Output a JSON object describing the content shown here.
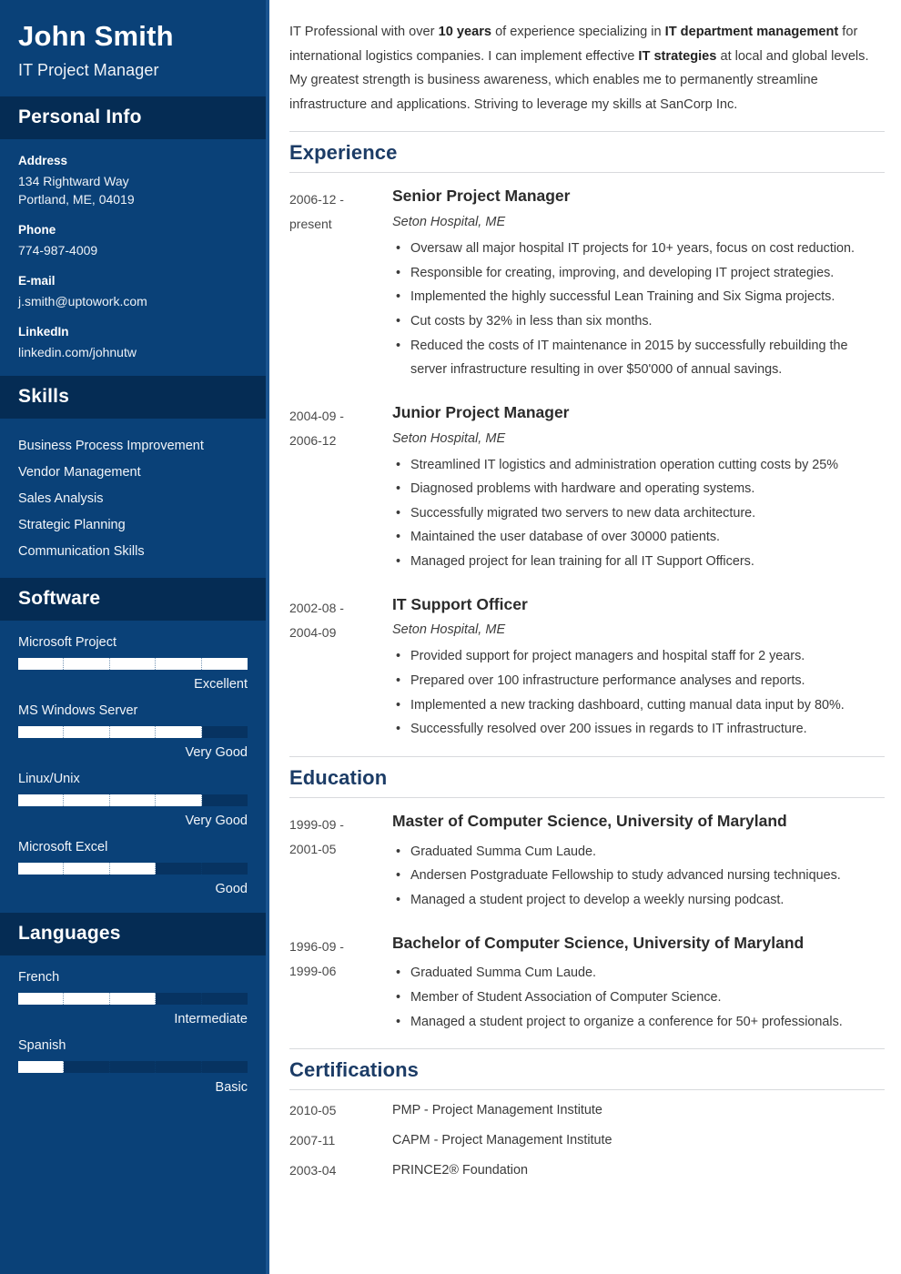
{
  "sidebar": {
    "name": "John Smith",
    "job_title": "IT Project Manager",
    "personal_info": {
      "heading": "Personal Info",
      "fields": [
        {
          "label": "Address",
          "value": "134 Rightward Way\nPortland, ME, 04019"
        },
        {
          "label": "Phone",
          "value": "774-987-4009"
        },
        {
          "label": "E-mail",
          "value": "j.smith@uptowork.com"
        },
        {
          "label": "LinkedIn",
          "value": "linkedin.com/johnutw"
        }
      ]
    },
    "skills": {
      "heading": "Skills",
      "items": [
        "Business Process Improvement",
        "Vendor Management",
        "Sales Analysis",
        "Strategic Planning",
        "Communication Skills"
      ]
    },
    "software": {
      "heading": "Software",
      "items": [
        {
          "name": "Microsoft Project",
          "level": "Excellent",
          "percent": 100
        },
        {
          "name": "MS Windows Server",
          "level": "Very Good",
          "percent": 80
        },
        {
          "name": "Linux/Unix",
          "level": "Very Good",
          "percent": 80
        },
        {
          "name": "Microsoft Excel",
          "level": "Good",
          "percent": 60
        }
      ]
    },
    "languages": {
      "heading": "Languages",
      "items": [
        {
          "name": "French",
          "level": "Intermediate",
          "percent": 60
        },
        {
          "name": "Spanish",
          "level": "Basic",
          "percent": 20
        }
      ]
    }
  },
  "main": {
    "summary": {
      "part1": "IT Professional with over ",
      "bold1": "10 years",
      "part2": " of experience specializing in ",
      "bold2": "IT department management",
      "part3": " for international logistics companies. I can implement effective ",
      "bold3": "IT strategies",
      "part4": " at local and global levels. My greatest strength is business awareness, which enables me to permanently streamline infrastructure and applications. Striving to leverage my skills at SanCorp Inc."
    },
    "experience": {
      "heading": "Experience",
      "entries": [
        {
          "date": "2006-12 -\npresent",
          "title": "Senior Project Manager",
          "subtitle": "Seton Hospital, ME",
          "bullets": [
            "Oversaw all major hospital IT projects for 10+ years, focus on cost reduction.",
            "Responsible for creating, improving, and developing IT project strategies.",
            "Implemented the highly successful Lean Training and Six Sigma projects.",
            "Cut costs by 32% in less than six months.",
            "Reduced the costs of IT maintenance in 2015 by successfully rebuilding the server infrastructure resulting in over $50'000 of annual savings."
          ]
        },
        {
          "date": "2004-09 -\n2006-12",
          "title": "Junior Project Manager",
          "subtitle": "Seton Hospital, ME",
          "bullets": [
            "Streamlined IT logistics and administration operation cutting costs by 25%",
            "Diagnosed problems with hardware and operating systems.",
            "Successfully migrated two servers to new data architecture.",
            "Maintained the user database of over 30000 patients.",
            "Managed project for lean training for all IT Support Officers."
          ]
        },
        {
          "date": "2002-08 -\n2004-09",
          "title": "IT Support Officer",
          "subtitle": "Seton Hospital, ME",
          "bullets": [
            "Provided support for project managers and hospital staff for 2 years.",
            "Prepared over 100 infrastructure performance analyses and reports.",
            "Implemented a new tracking dashboard, cutting manual data input by 80%.",
            "Successfully resolved over 200 issues in regards to IT infrastructure."
          ]
        }
      ]
    },
    "education": {
      "heading": "Education",
      "entries": [
        {
          "date": "1999-09 -\n2001-05",
          "title": "Master of Computer Science, University of Maryland",
          "bullets": [
            "Graduated Summa Cum Laude.",
            "Andersen Postgraduate Fellowship to study advanced nursing techniques.",
            "Managed a student project to develop a weekly nursing podcast."
          ]
        },
        {
          "date": "1996-09 -\n1999-06",
          "title": "Bachelor of Computer Science, University of Maryland",
          "bullets": [
            "Graduated Summa Cum Laude.",
            "Member of Student Association of Computer Science.",
            "Managed a student project to organize a conference for 50+ professionals."
          ]
        }
      ]
    },
    "certifications": {
      "heading": "Certifications",
      "rows": [
        {
          "date": "2010-05",
          "text": "PMP - Project Management Institute"
        },
        {
          "date": "2007-11",
          "text": "CAPM - Project Management Institute"
        },
        {
          "date": "2003-04",
          "text": "PRINCE2® Foundation"
        }
      ]
    }
  },
  "colors": {
    "sidebar_bg": "#0a4178",
    "sidebar_band": "#052c54",
    "sidebar_edge": "#1a5490",
    "bar_track": "#073361",
    "bar_fill": "#ffffff",
    "heading": "#1c3c66",
    "rule": "#d8dadd"
  }
}
